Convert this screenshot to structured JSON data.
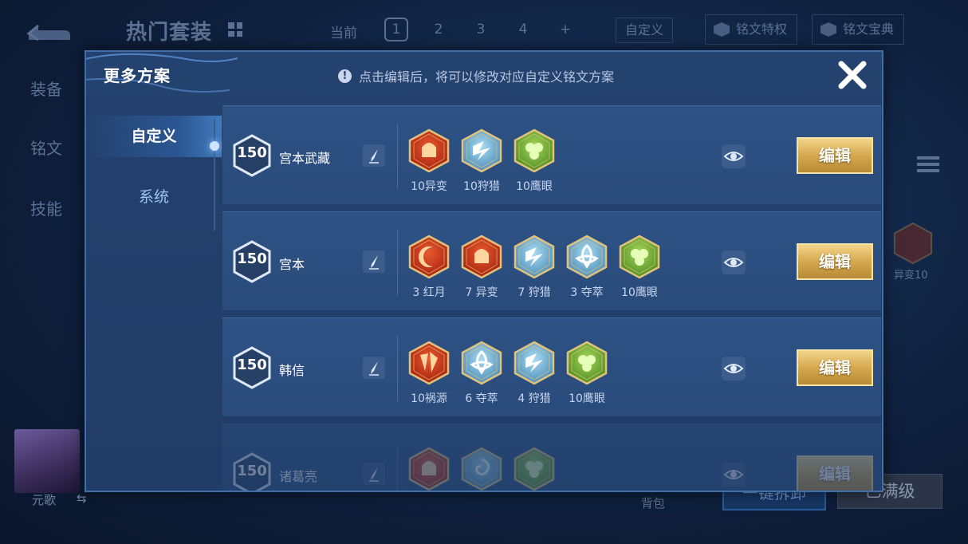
{
  "background": {
    "title": "热门套装",
    "current_label": "当前",
    "pages": [
      "1",
      "2",
      "3",
      "4",
      "+"
    ],
    "active_page": "1",
    "custom_label": "自定义",
    "privilege_label": "铭文特权",
    "codex_label": "铭文宝典",
    "side_tabs": [
      "装备",
      "铭文",
      "技能"
    ],
    "ghost_rune_label": "异变10",
    "hero_name": "元歌",
    "hero_swap": "⇆",
    "bag_label": "背包",
    "left_button_label": "一键拆卸",
    "right_button_label": "已满级"
  },
  "modal": {
    "title": "更多方案",
    "hint_icon": "!",
    "hint": "点击编辑后，将可以修改对应自定义铭文方案",
    "close_icon": "close-icon",
    "tabs": [
      {
        "label": "自定义",
        "active": true
      },
      {
        "label": "系统",
        "active": false
      }
    ]
  },
  "plans": [
    {
      "level": "150",
      "name": "宫本武藏",
      "edit_label": "编辑",
      "runes": [
        {
          "label": "10异变",
          "color": "red",
          "motif": "arch"
        },
        {
          "label": "10狩猎",
          "color": "blue",
          "motif": "bolt"
        },
        {
          "label": "10鹰眼",
          "color": "green",
          "motif": "clover"
        }
      ]
    },
    {
      "level": "150",
      "name": "宫本",
      "edit_label": "编辑",
      "runes": [
        {
          "label": "3 红月",
          "color": "red",
          "motif": "moon"
        },
        {
          "label": "7 异变",
          "color": "red",
          "motif": "arch"
        },
        {
          "label": "7 狩猎",
          "color": "blue",
          "motif": "bolt"
        },
        {
          "label": "3 夺萃",
          "color": "blue",
          "motif": "knot"
        },
        {
          "label": "10鹰眼",
          "color": "green",
          "motif": "clover"
        }
      ]
    },
    {
      "level": "150",
      "name": "韩信",
      "edit_label": "编辑",
      "runes": [
        {
          "label": "10祸源",
          "color": "red",
          "motif": "shards"
        },
        {
          "label": "6 夺萃",
          "color": "blue",
          "motif": "knot"
        },
        {
          "label": "4 狩猎",
          "color": "blue",
          "motif": "bolt"
        },
        {
          "label": "10鹰眼",
          "color": "green",
          "motif": "clover"
        }
      ]
    },
    {
      "level": "150",
      "name": "诸葛亮",
      "edit_label": "编辑",
      "runes": [
        {
          "label": "",
          "color": "red",
          "motif": "arch"
        },
        {
          "label": "",
          "color": "blue",
          "motif": "swirl"
        },
        {
          "label": "",
          "color": "green",
          "motif": "clover"
        }
      ]
    }
  ],
  "colors": {
    "gold": "#d6a94f",
    "rune_red": "#d44a28",
    "rune_blue": "#7fb8dc",
    "rune_green": "#7bbf3e",
    "rune_frame": "#e2c27a"
  }
}
